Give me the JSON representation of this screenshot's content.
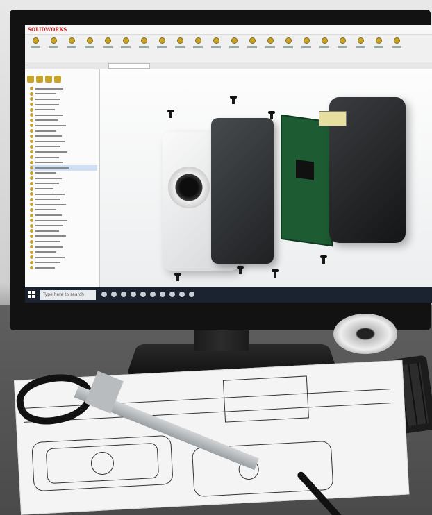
{
  "app": {
    "logo_text": "SOLIDWORKS",
    "accent_color": "#c42727"
  },
  "taskbar": {
    "search_placeholder": "Type here to search"
  },
  "scene": {
    "icons": [
      "monitor-icon",
      "keyboard-icon",
      "caliper-icon",
      "pliers-icon",
      "pen-icon"
    ]
  }
}
